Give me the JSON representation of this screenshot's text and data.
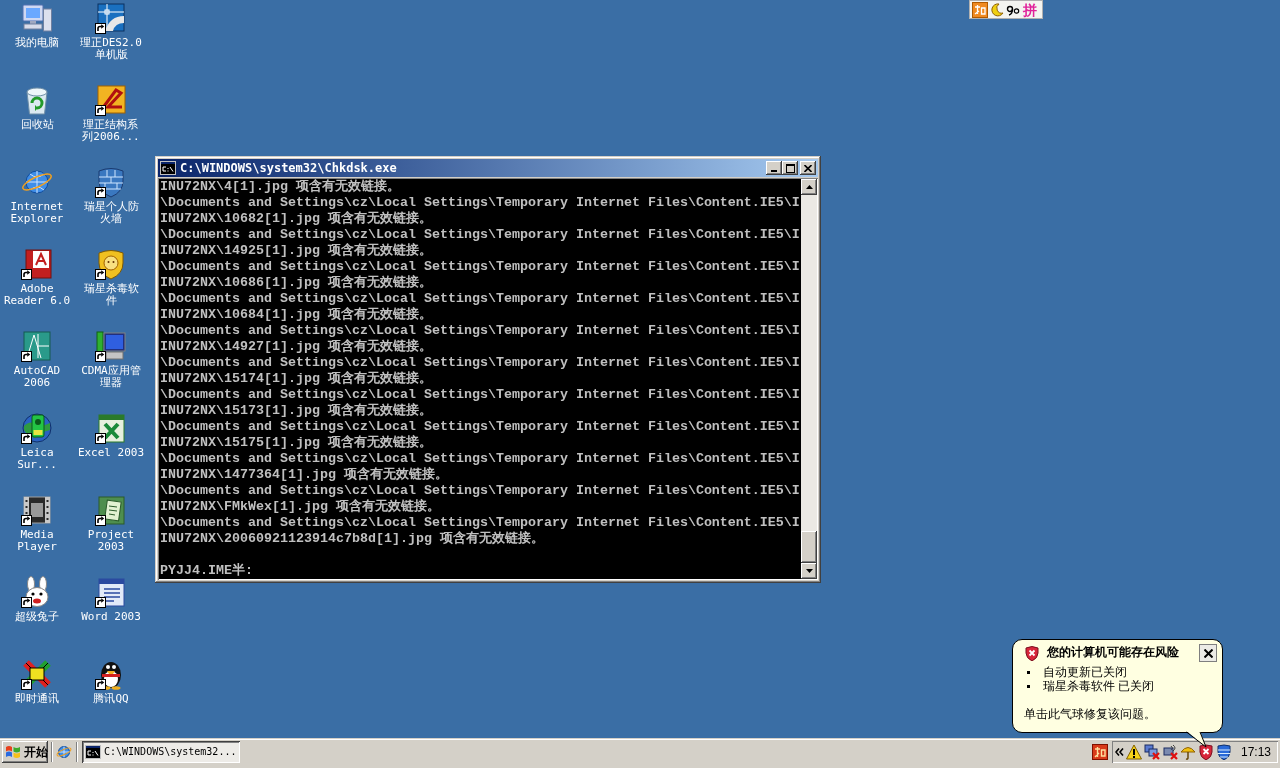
{
  "desktop_icons": [
    {
      "label": [
        "我的电脑"
      ],
      "shortcut": false
    },
    {
      "label": [
        "回收站"
      ],
      "shortcut": false
    },
    {
      "label": [
        "Internet",
        "Explorer"
      ],
      "shortcut": false
    },
    {
      "label": [
        "Adobe",
        "Reader 6.0"
      ],
      "shortcut": true
    },
    {
      "label": [
        "AutoCAD",
        "2006"
      ],
      "shortcut": true
    },
    {
      "label": [
        "Leica",
        "Sur..."
      ],
      "shortcut": true
    },
    {
      "label": [
        "Media",
        "Player"
      ],
      "shortcut": true
    },
    {
      "label": [
        "超级兔子"
      ],
      "shortcut": true
    },
    {
      "label": [
        "即时通讯"
      ],
      "shortcut": true
    },
    {
      "label": [
        "理正DES2.0",
        "单机版"
      ],
      "shortcut": true
    },
    {
      "label": [
        "理正结构系",
        "列2006..."
      ],
      "shortcut": true
    },
    {
      "label": [
        "瑞星个人防",
        "火墙"
      ],
      "shortcut": true
    },
    {
      "label": [
        "瑞星杀毒软",
        "件"
      ],
      "shortcut": true
    },
    {
      "label": [
        "CDMA应用管",
        "理器"
      ],
      "shortcut": true
    },
    {
      "label": [
        "Excel 2003"
      ],
      "shortcut": true
    },
    {
      "label": [
        "Project",
        "2003"
      ],
      "shortcut": true
    },
    {
      "label": [
        "Word 2003"
      ],
      "shortcut": true
    },
    {
      "label": [
        "腾讯QQ"
      ],
      "shortcut": true
    }
  ],
  "ime_bar": {
    "mode": "拼"
  },
  "console_window": {
    "title": "C:\\WINDOWS\\system32\\Chkdsk.exe",
    "lines": [
      "INU72NX\\4[1].jpg 项含有无效链接。",
      "\\Documents and Settings\\cz\\Local Settings\\Temporary Internet Files\\Content.IE5\\I",
      "INU72NX\\10682[1].jpg 项含有无效链接。",
      "\\Documents and Settings\\cz\\Local Settings\\Temporary Internet Files\\Content.IE5\\I",
      "INU72NX\\14925[1].jpg 项含有无效链接。",
      "\\Documents and Settings\\cz\\Local Settings\\Temporary Internet Files\\Content.IE5\\I",
      "INU72NX\\10686[1].jpg 项含有无效链接。",
      "\\Documents and Settings\\cz\\Local Settings\\Temporary Internet Files\\Content.IE5\\I",
      "INU72NX\\10684[1].jpg 项含有无效链接。",
      "\\Documents and Settings\\cz\\Local Settings\\Temporary Internet Files\\Content.IE5\\I",
      "INU72NX\\14927[1].jpg 项含有无效链接。",
      "\\Documents and Settings\\cz\\Local Settings\\Temporary Internet Files\\Content.IE5\\I",
      "INU72NX\\15174[1].jpg 项含有无效链接。",
      "\\Documents and Settings\\cz\\Local Settings\\Temporary Internet Files\\Content.IE5\\I",
      "INU72NX\\15173[1].jpg 项含有无效链接。",
      "\\Documents and Settings\\cz\\Local Settings\\Temporary Internet Files\\Content.IE5\\I",
      "INU72NX\\15175[1].jpg 项含有无效链接。",
      "\\Documents and Settings\\cz\\Local Settings\\Temporary Internet Files\\Content.IE5\\I",
      "INU72NX\\1477364[1].jpg 项含有无效链接。",
      "\\Documents and Settings\\cz\\Local Settings\\Temporary Internet Files\\Content.IE5\\I",
      "INU72NX\\FMkWex[1].jpg 项含有无效链接。",
      "\\Documents and Settings\\cz\\Local Settings\\Temporary Internet Files\\Content.IE5\\I",
      "INU72NX\\20060921123914c7b8d[1].jpg 项含有无效链接。"
    ],
    "prompt": "PYJJ4.IME半:"
  },
  "balloon": {
    "title": "您的计算机可能存在风险",
    "items": [
      "自动更新已关闭",
      "瑞星杀毒软件 已关闭"
    ],
    "message": "单击此气球修复该问题。"
  },
  "taskbar": {
    "start_button": "开始",
    "tasks": [
      {
        "label": "C:\\WINDOWS\\system32...",
        "selected": true
      }
    ],
    "clock": "17:13"
  }
}
